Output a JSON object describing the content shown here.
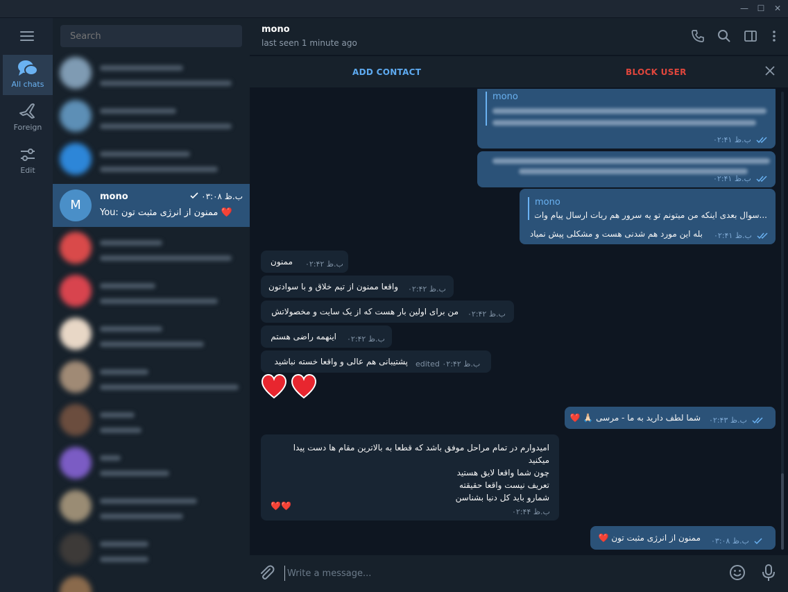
{
  "window": {
    "min": "—",
    "max": "☐",
    "close": "✕"
  },
  "rail": {
    "folders": [
      {
        "label": "All chats",
        "icon": "chats-icon"
      },
      {
        "label": "Foreign",
        "icon": "airplane-icon"
      },
      {
        "label": "Edit",
        "icon": "sliders-icon"
      }
    ]
  },
  "search": {
    "placeholder": "Search"
  },
  "active_chat": {
    "avatar_letter": "M",
    "name": "mono",
    "time": "ب.ظ ۰۳:۰۸",
    "preview": "You: ممنون از انرژی مثبت تون ❤️"
  },
  "header": {
    "name": "mono",
    "status": "last seen 1 minute ago"
  },
  "actions": {
    "add": "ADD CONTACT",
    "block": "BLOCK USER"
  },
  "messages": {
    "quote_name": "mono",
    "q1_time": "ب.ظ ۰۲:۴۱",
    "q2_time": "ب.ظ ۰۲:۴۱",
    "q3_quote": "...سوال بعدی اینکه من میتونم تو یه سرور هم ربات ارسال پیام وات",
    "q3_text": "بله این مورد هم شدنی هست و مشکلی پیش نمیاد",
    "q3_time": "ب.ظ ۰۲:۴۱",
    "m1_text": "ممنون",
    "m1_time": "ب.ظ ۰۲:۴۲",
    "m2_text": "واقعا ممنون از تیم خلاق و با سوادتون",
    "m2_time": "ب.ظ ۰۲:۴۲",
    "m3_text": "من برای اولین بار هست که از یک سایت و مخصولاتش",
    "m3_time": "ب.ظ ۰۲:۴۲",
    "m4_text": "اینهمه راضی هستم",
    "m4_time": "ب.ظ ۰۲:۴۲",
    "m5_text": "پشتیبانی هم عالی و واقعا خسته نباشید",
    "m5_time": "edited ب.ظ ۰۲:۴۲",
    "o1_text": "شما لطف دارید به ما - مرسی 🙏🏻 ❤️",
    "o1_time": "ب.ظ ۰۲:۴۳",
    "m6_line1": "امیدوارم در تمام مراحل موفق باشد که قطعا به بالاترین مقام ها دست پیدا",
    "m6_line2": "میکنید",
    "m6_line3": "چون شما واقعا لایق هستید",
    "m6_line4": "تعریف نیست واقعا حقیقته",
    "m6_line5": "شمارو باید کل دنیا بشناسن",
    "m6_hearts": "❤️❤️",
    "m6_time": "ب.ظ ۰۲:۴۴",
    "o2_text": "ممنون از انرژی مثبت تون ❤️",
    "o2_time": "ب.ظ ۰۳:۰۸"
  },
  "composer": {
    "placeholder": "Write a message..."
  },
  "colors": {
    "accent": "#6ab2f2",
    "outgoing": "#2b5278",
    "incoming": "#182533",
    "danger": "#e0463c"
  }
}
